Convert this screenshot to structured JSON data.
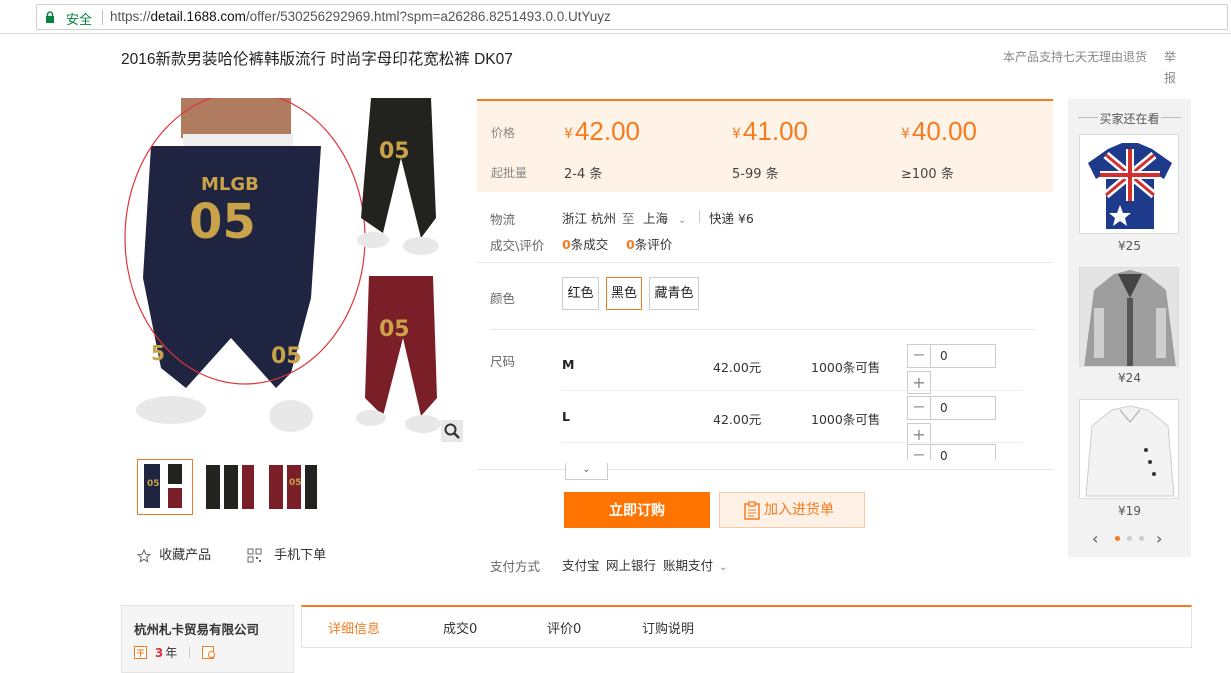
{
  "browser": {
    "secure_label": "安全",
    "url_scheme": "https://",
    "url_host": "detail.1688.com",
    "url_path": "/offer/530256292969.html?spm=a26286.8251493.0.0.UtYuyz"
  },
  "product": {
    "title": "2016新款男装哈伦裤韩版流行 时尚字母印花宽松裤 DK07",
    "return_notice": "本产品支持七天无理由退货",
    "report_label": "举报"
  },
  "actions": {
    "favorite_label": "收藏产品",
    "mobile_order_label": "手机下单"
  },
  "pricing": {
    "price_label": "价格",
    "moq_label": "起批量",
    "currency_symbol": "¥",
    "tiers": [
      {
        "price": "42.00",
        "qty": "2-4 条"
      },
      {
        "price": "41.00",
        "qty": "5-99 条"
      },
      {
        "price": "40.00",
        "qty": "≥100 条"
      }
    ],
    "accent_color": "#f57b20"
  },
  "logistics": {
    "label": "物流",
    "origin": "浙江 杭州",
    "to": "至",
    "destination": "上海",
    "express": "快递 ¥6"
  },
  "deals": {
    "label": "成交\\评价",
    "sold_count": "0",
    "sold_suffix": "条成交",
    "review_count": "0",
    "review_suffix": "条评价"
  },
  "colors": {
    "label": "颜色",
    "options": [
      "红色",
      "黑色",
      "藏青色"
    ],
    "selected": "黑色"
  },
  "sizes": {
    "label": "尺码",
    "rows": [
      {
        "name": "M",
        "price": "42.00元",
        "stock": "1000条可售",
        "qty": "0"
      },
      {
        "name": "L",
        "price": "42.00元",
        "stock": "1000条可售",
        "qty": "0"
      },
      {
        "name": "",
        "price": "",
        "stock": "",
        "qty": "0"
      }
    ]
  },
  "buttons": {
    "order_now": "立即订购",
    "add_to_list": "加入进货单"
  },
  "payment": {
    "label": "支付方式",
    "methods": [
      "支付宝",
      "网上银行",
      "账期支付"
    ]
  },
  "recommendations": {
    "heading": "买家还在看",
    "items": [
      {
        "price": "¥25",
        "icon": "flag-tshirt"
      },
      {
        "price": "¥24",
        "icon": "grey-hoodie"
      },
      {
        "price": "¥19",
        "icon": "white-sweater"
      }
    ]
  },
  "company": {
    "name": "杭州札卡贸易有限公司",
    "years": "3",
    "years_unit": "年"
  },
  "tabs": [
    "详细信息",
    "成交0",
    "评价0",
    "订购说明"
  ]
}
